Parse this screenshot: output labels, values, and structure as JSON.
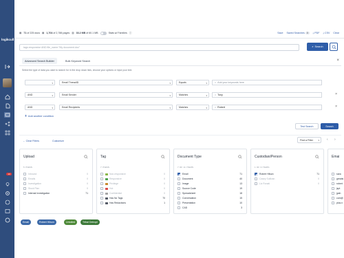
{
  "app": {
    "logo": "logikcull"
  },
  "stats": {
    "docs_bold": "71",
    "docs_rest": "of 225 docs",
    "pages_bold": "1,704",
    "pages_rest": "of 2,788 pages",
    "size_bold": "33.2 MB",
    "size_rest": "of 60.1 MB",
    "families_label": "Stats w/ Families"
  },
  "toplinks": {
    "save": "Save",
    "saved": "Saved Searches",
    "saved_count": "0",
    "pdf": "PDF",
    "csv": "CSV",
    "clear": "Clear"
  },
  "search": {
    "placeholder": "tags:responsive AND file_name:\"My document.doc\"",
    "button": "Search"
  },
  "tabs": {
    "advanced": "Advanced Search Builder",
    "bulk": "Bulk Keyword Search"
  },
  "hint": "Select the type of data you want to search for in the drop down lists, choose your options or input your text.",
  "conditions": [
    {
      "op": "",
      "field": "Email ThreadID",
      "match": "Equals",
      "value": "Add your keywords here",
      "placeholder": true
    },
    {
      "op": "AND",
      "field": "Email Sender",
      "match": "Matches",
      "value": "Tony",
      "placeholder": false
    },
    {
      "op": "AND",
      "field": "Email Recipients",
      "match": "Matches",
      "value": "Robert",
      "placeholder": false
    }
  ],
  "add_condition": "Add another condition",
  "buttons": {
    "test": "Test Search",
    "search": "Search"
  },
  "filters": {
    "clear": "Clear Filters",
    "customize": "Customize",
    "find": "Find a Filter"
  },
  "cards": [
    {
      "title": "Upload",
      "count": "5 ITEMS",
      "items": [
        {
          "label": "Inbound",
          "count": "0",
          "checked": false,
          "muted": true
        },
        {
          "label": "Emails",
          "count": "0",
          "checked": false,
          "muted": true
        },
        {
          "label": "Investigation",
          "count": "0",
          "checked": false,
          "muted": true
        },
        {
          "label": "Stock Plan",
          "count": "0",
          "checked": false,
          "muted": true
        },
        {
          "label": "Internal Investigation",
          "count": "71",
          "checked": false,
          "muted": false
        }
      ]
    },
    {
      "title": "Tag",
      "count": "7 ITEMS",
      "items": [
        {
          "label": "Non-responsive",
          "count": "0",
          "checked": false,
          "muted": true,
          "color": "#8bb84b"
        },
        {
          "label": "Responsive",
          "count": "0",
          "checked": false,
          "muted": true,
          "color": "#4da24f"
        },
        {
          "label": "Privilege",
          "count": "0",
          "checked": false,
          "muted": true,
          "color": "#c9892c"
        },
        {
          "label": "Hot",
          "count": "0",
          "checked": false,
          "muted": true,
          "color": "#d94b4b"
        },
        {
          "label": "Confidential",
          "count": "0",
          "checked": false,
          "muted": true,
          "color": "#a6a6a6"
        },
        {
          "label": "Has No Tags",
          "count": "70",
          "checked": false,
          "muted": false,
          "color": "#555b66"
        },
        {
          "label": "Has Redactions",
          "count": "1",
          "checked": false,
          "muted": false,
          "color": "#555b66"
        }
      ]
    },
    {
      "title": "Document Type",
      "count": "7 OF 11 ITEMS",
      "items": [
        {
          "label": "Email",
          "count": "71",
          "checked": true,
          "muted": false
        },
        {
          "label": "Document",
          "count": "40",
          "checked": false,
          "muted": false
        },
        {
          "label": "Image",
          "count": "13",
          "checked": false,
          "muted": false
        },
        {
          "label": "Source Code",
          "count": "19",
          "checked": false,
          "muted": false
        },
        {
          "label": "Spreadsheet",
          "count": "18",
          "checked": false,
          "muted": false
        },
        {
          "label": "Conversation",
          "count": "15",
          "checked": false,
          "muted": false
        },
        {
          "label": "Presentation",
          "count": "10",
          "checked": false,
          "muted": false
        },
        {
          "label": "CAD",
          "count": "3",
          "checked": false,
          "muted": false
        }
      ]
    },
    {
      "title": "Custodian/Person",
      "count": "1 OF 3 ITEMS",
      "items": [
        {
          "label": "Robert Hilson",
          "count": "71",
          "checked": true,
          "muted": false
        },
        {
          "label": "Casey Sullivan",
          "count": "0",
          "checked": false,
          "muted": true
        },
        {
          "label": "Liz Ronati",
          "count": "0",
          "checked": false,
          "muted": true
        }
      ]
    },
    {
      "title": "Emai",
      "count": "",
      "items": [
        {
          "label": "sara",
          "count": "",
          "checked": false,
          "muted": false
        },
        {
          "label": "greatsi",
          "count": "",
          "checked": false,
          "muted": false
        },
        {
          "label": "robert",
          "count": "",
          "checked": false,
          "muted": false
        },
        {
          "label": "jspt",
          "count": "",
          "checked": false,
          "muted": false
        },
        {
          "label": "jpah",
          "count": "",
          "checked": false,
          "muted": false
        },
        {
          "label": "com@",
          "count": "",
          "checked": false,
          "muted": false
        },
        {
          "label": "plus.n",
          "count": "",
          "checked": false,
          "muted": false
        }
      ]
    }
  ],
  "chips": [
    {
      "label": "Email",
      "color": "#3d6aa8"
    },
    {
      "label": "Robert Hilson",
      "color": "#3d6aa8"
    },
    {
      "label": "Untolled",
      "color": "#4f8a3a"
    },
    {
      "label": "Tribal Detropt",
      "color": "#3d7a3a"
    }
  ]
}
